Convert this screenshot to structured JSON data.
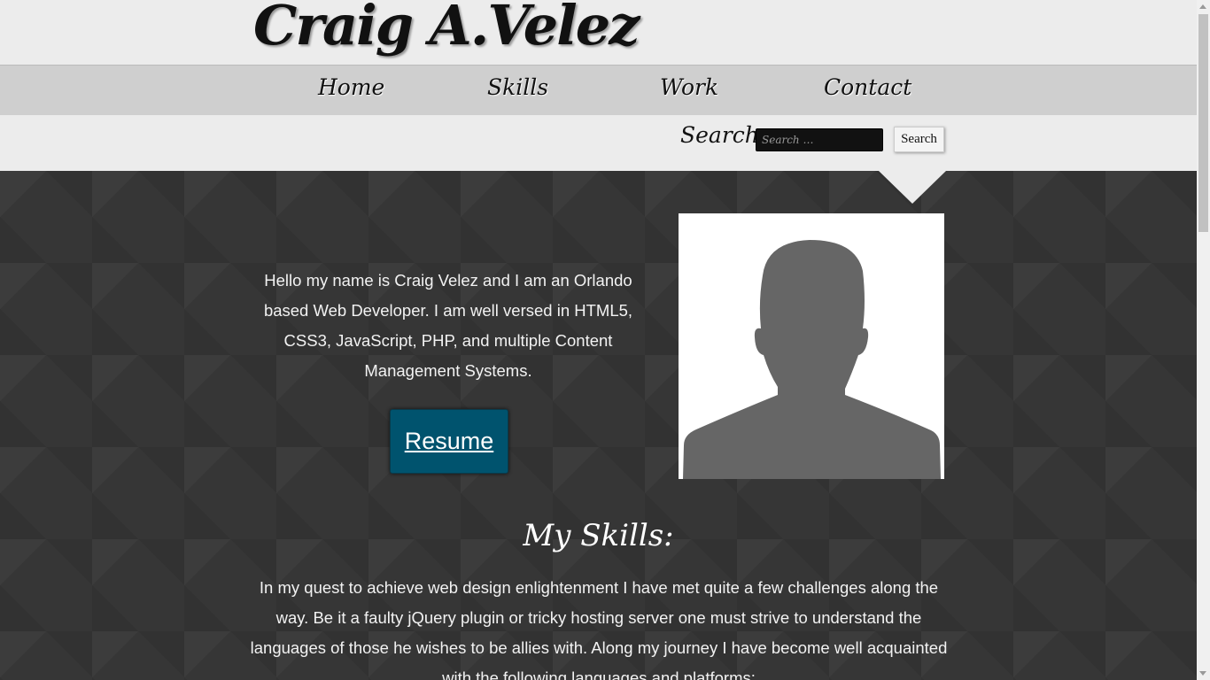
{
  "header": {
    "logo": "Craig A.Velez"
  },
  "nav": {
    "items": [
      {
        "label": "Home"
      },
      {
        "label": "Skills"
      },
      {
        "label": "Work"
      },
      {
        "label": "Contact"
      }
    ]
  },
  "search": {
    "label": "Search:",
    "placeholder": "Search …",
    "value": "",
    "button": "Search"
  },
  "intro": {
    "text": "Hello my name is Craig Velez and I am an Orlando based Web Developer. I am well versed in HTML5, CSS3, JavaScript, PHP, and multiple Content Management Systems.",
    "resume_label": "Resume"
  },
  "skills": {
    "title": "My Skills:",
    "text": "In my quest to achieve web design enlightenment I have met quite a few challenges along the way. Be it a faulty jQuery plugin or tricky hosting server one must strive to understand the languages of those he wishes to be allies with. Along my journey I have become well acquainted with the following languages and platforms:"
  }
}
